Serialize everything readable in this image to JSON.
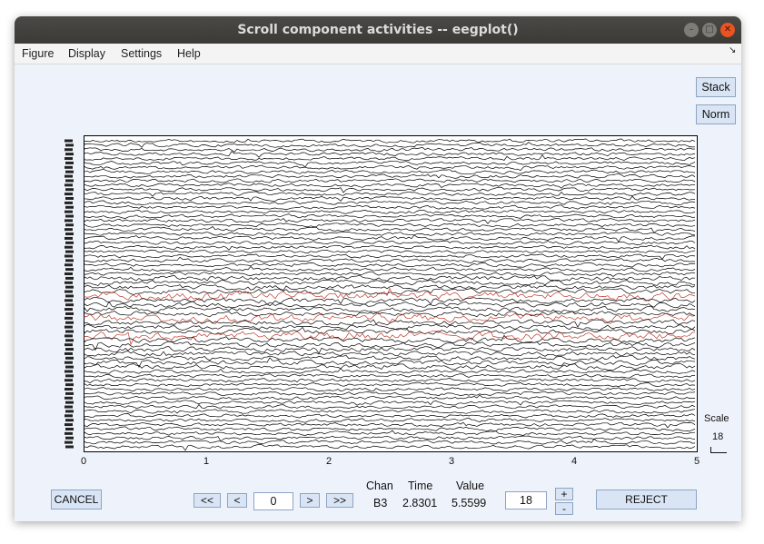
{
  "window": {
    "title": "Scroll component activities -- eegplot()"
  },
  "menu": [
    "Figure",
    "Display",
    "Settings",
    "Help"
  ],
  "side_buttons": {
    "stack": "Stack",
    "norm": "Norm"
  },
  "plot": {
    "x_ticks": [
      "0",
      "1",
      "2",
      "3",
      "4",
      "5"
    ],
    "xlim": [
      0,
      5
    ],
    "trace_color": "#000000",
    "selected_color": "#c0392b"
  },
  "scale": {
    "label": "Scale",
    "value": "18"
  },
  "controls": {
    "cancel": "CANCEL",
    "first": "<<",
    "prev": "<",
    "position": "0",
    "next": ">",
    "last": ">>",
    "scale_value": "18",
    "plus": "+",
    "minus": "-",
    "reject": "REJECT"
  },
  "info": {
    "chan_label": "Chan",
    "time_label": "Time",
    "value_label": "Value",
    "chan": "B3",
    "time": "2.8301",
    "value": "5.5599"
  }
}
